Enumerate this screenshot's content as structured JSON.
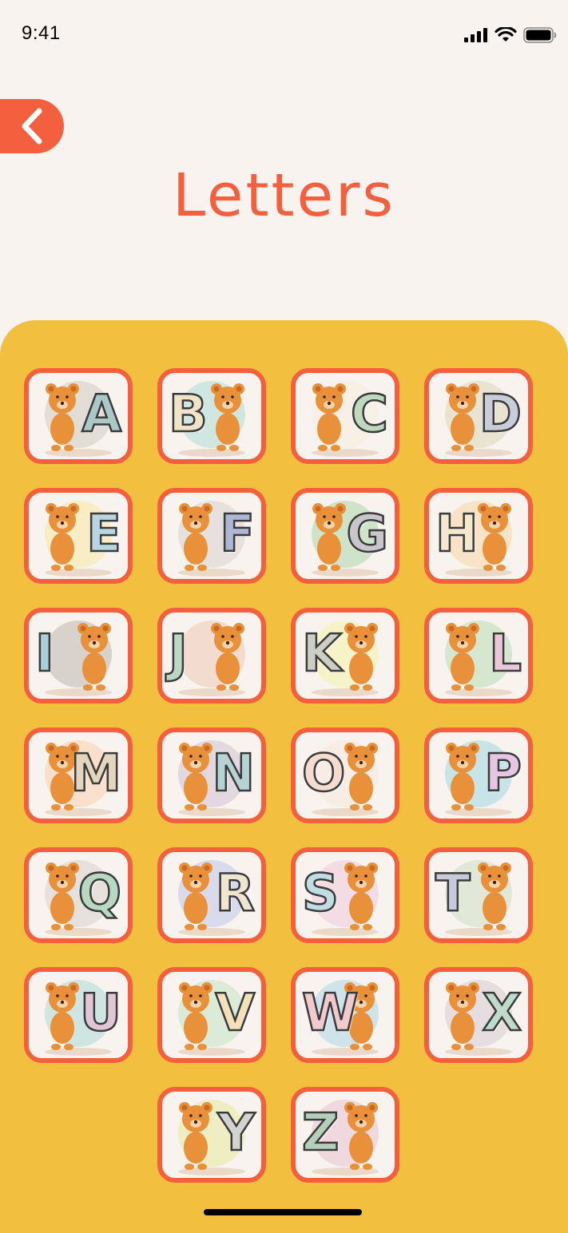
{
  "status_bar": {
    "time": "9:41"
  },
  "header": {
    "title": "Letters"
  },
  "colors": {
    "accent": "#F4603E",
    "panel": "#F3BF3F",
    "background": "#F8F3EF",
    "bear": "#E8913A"
  },
  "letters": [
    {
      "letter": "A",
      "color": "#A9C8C6",
      "bg_color": "#E2DDD5",
      "bear_side": "left"
    },
    {
      "letter": "B",
      "color": "#EFE3C8",
      "bg_color": "#CFE6E1",
      "bear_side": "right"
    },
    {
      "letter": "C",
      "color": "#BFD9BD",
      "bg_color": "#F8EFE5",
      "bear_side": "left"
    },
    {
      "letter": "D",
      "color": "#C8CDD9",
      "bg_color": "#E9E3D1",
      "bear_side": "left"
    },
    {
      "letter": "E",
      "color": "#B9D5DF",
      "bg_color": "#F8EDC4",
      "bear_side": "left"
    },
    {
      "letter": "F",
      "color": "#AEB8D6",
      "bg_color": "#E6E1DC",
      "bear_side": "left"
    },
    {
      "letter": "G",
      "color": "#C9C6CB",
      "bg_color": "#CFE3C8",
      "bear_side": "left"
    },
    {
      "letter": "H",
      "color": "#F4E8CF",
      "bg_color": "#F9E3C7",
      "bear_side": "right"
    },
    {
      "letter": "I",
      "color": "#A9D0DA",
      "bg_color": "#D7D3CC",
      "bear_side": "right"
    },
    {
      "letter": "J",
      "color": "#B9D9C2",
      "bg_color": "#F3DBD0",
      "bear_side": "right"
    },
    {
      "letter": "K",
      "color": "#CCCFC6",
      "bg_color": "#F6F3C9",
      "bear_side": "right"
    },
    {
      "letter": "L",
      "color": "#EBC6D9",
      "bg_color": "#D5E7CF",
      "bear_side": "left"
    },
    {
      "letter": "M",
      "color": "#E4D6BE",
      "bg_color": "#F8E0CC",
      "bear_side": "left"
    },
    {
      "letter": "N",
      "color": "#B6D3D3",
      "bg_color": "#E3D7E0",
      "bear_side": "left"
    },
    {
      "letter": "O",
      "color": "#F4DCD1",
      "bg_color": "#F8EDE5",
      "bear_side": "right"
    },
    {
      "letter": "P",
      "color": "#E6C6E2",
      "bg_color": "#C9E4E9",
      "bear_side": "left"
    },
    {
      "letter": "Q",
      "color": "#B8D9C1",
      "bg_color": "#E6E1DC",
      "bear_side": "left"
    },
    {
      "letter": "R",
      "color": "#EFE6D2",
      "bg_color": "#D9DAEB",
      "bear_side": "left"
    },
    {
      "letter": "S",
      "color": "#C0DDE3",
      "bg_color": "#F4DCE5",
      "bear_side": "right"
    },
    {
      "letter": "T",
      "color": "#C8C9DB",
      "bg_color": "#E1E8D8",
      "bear_side": "right"
    },
    {
      "letter": "U",
      "color": "#E1C6D6",
      "bg_color": "#CFE5E1",
      "bear_side": "left"
    },
    {
      "letter": "V",
      "color": "#F4E1BC",
      "bg_color": "#DCEBD8",
      "bear_side": "left"
    },
    {
      "letter": "W",
      "color": "#F2C9CF",
      "bg_color": "#CFE3EA",
      "bear_side": "right"
    },
    {
      "letter": "X",
      "color": "#BFDBCB",
      "bg_color": "#E5DDE0",
      "bear_side": "left"
    },
    {
      "letter": "Y",
      "color": "#D3D3D0",
      "bg_color": "#EFEDC2",
      "bear_side": "left"
    },
    {
      "letter": "Z",
      "color": "#B4D0BA",
      "bg_color": "#EFD9DE",
      "bear_side": "right"
    }
  ]
}
